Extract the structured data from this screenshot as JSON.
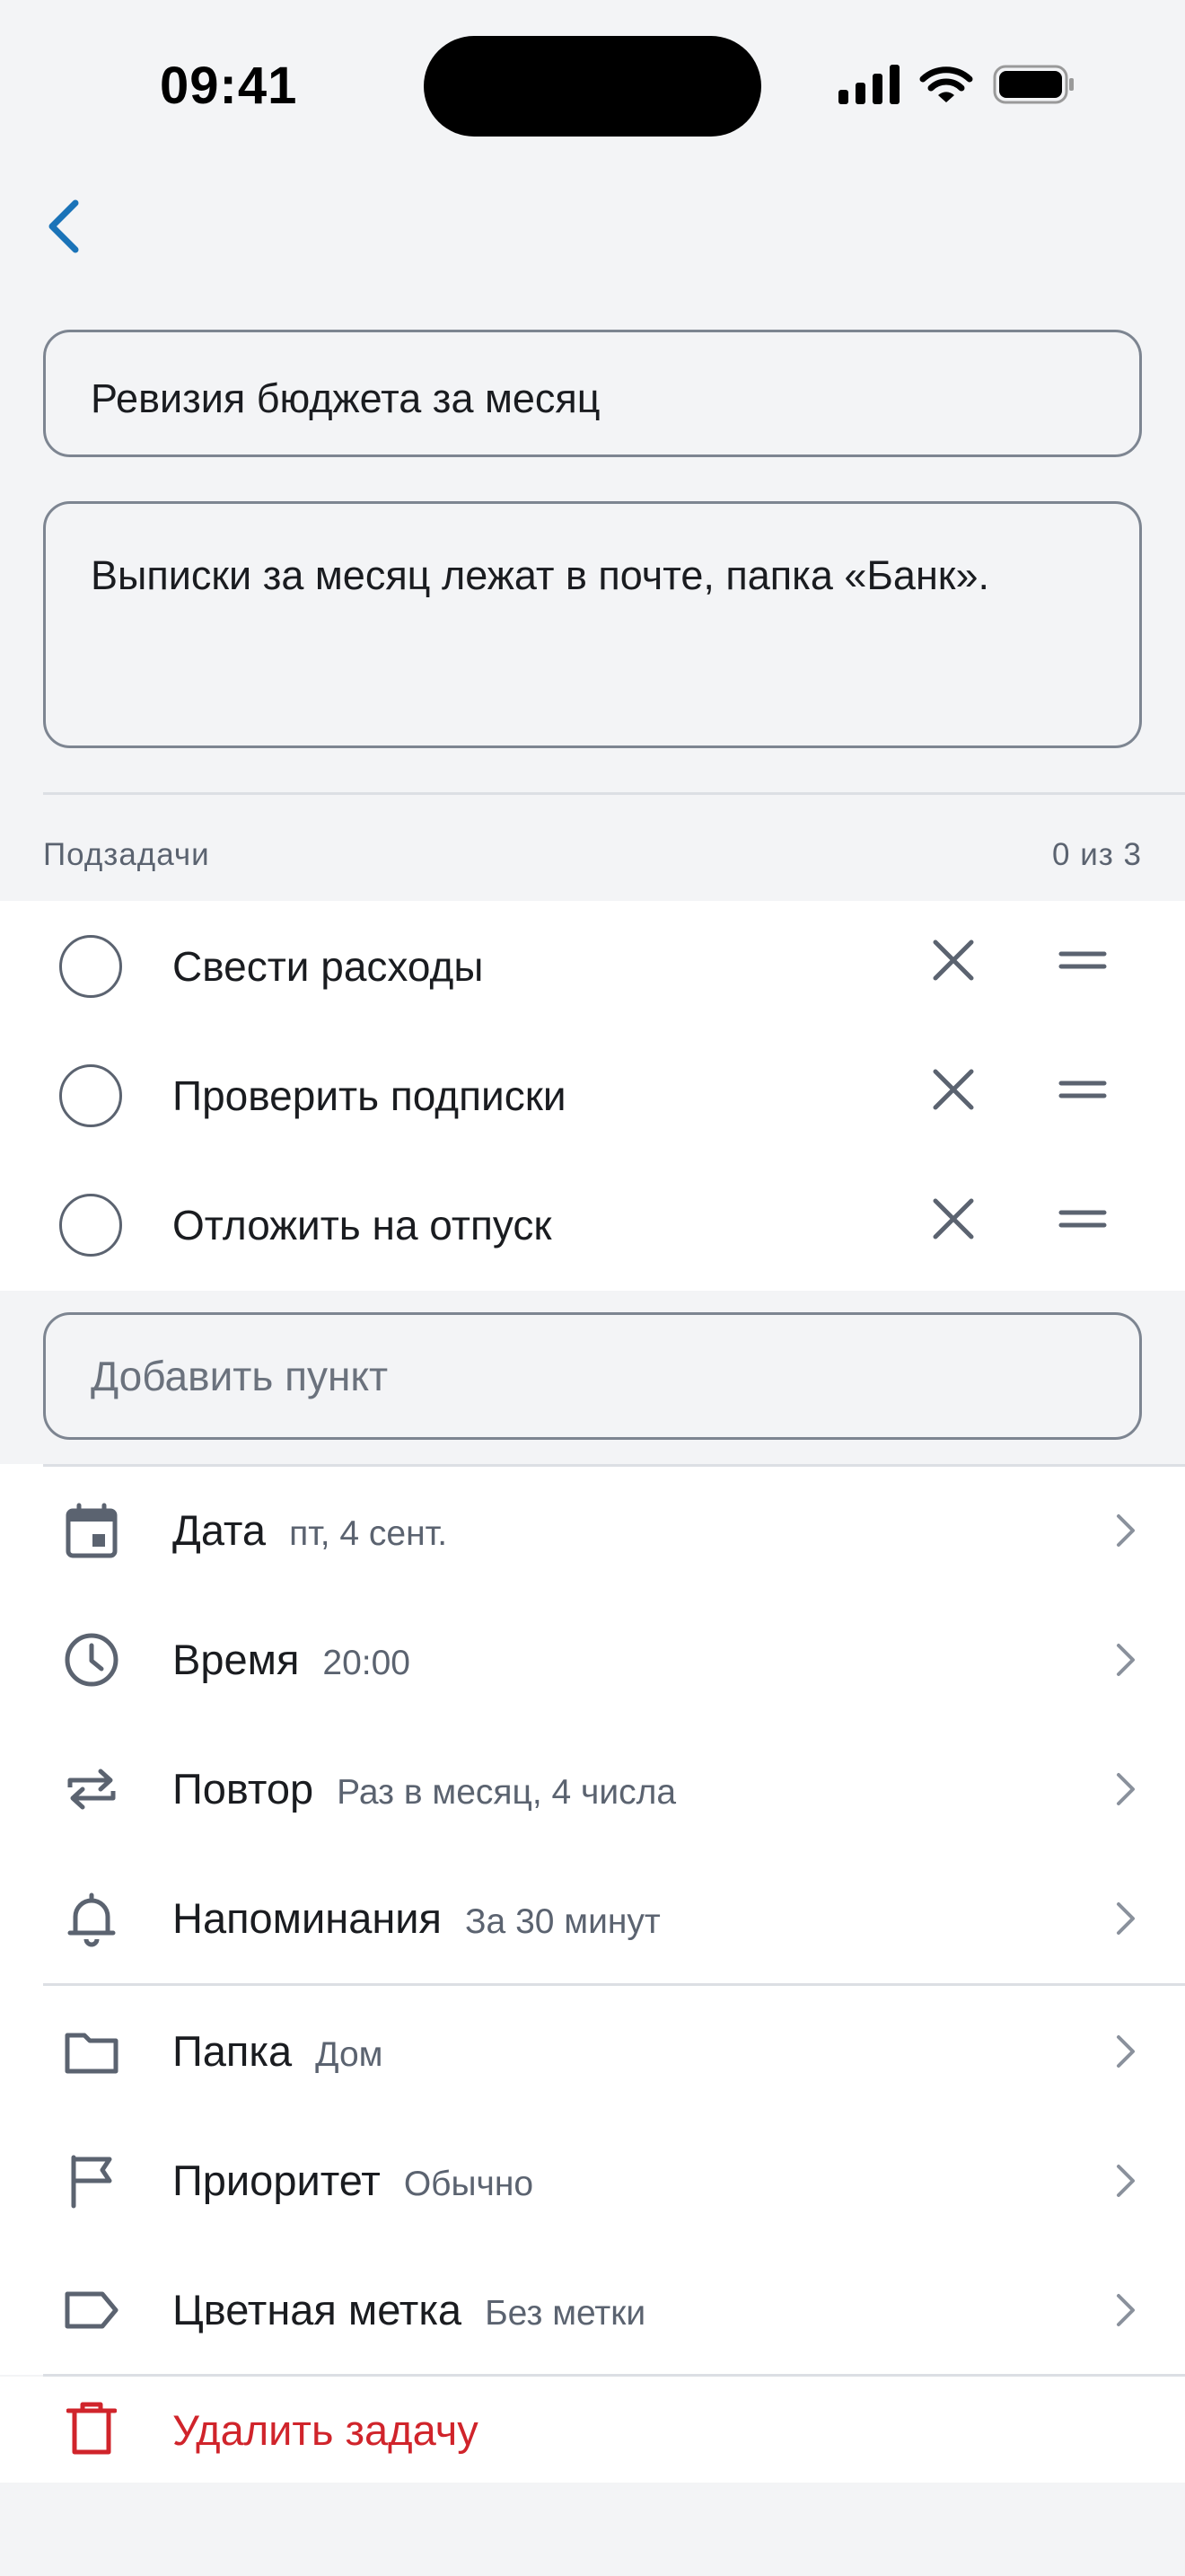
{
  "status_bar": {
    "time": "09:41"
  },
  "task": {
    "title": "Ревизия бюджета за месяц",
    "description": "Выписки за месяц лежат в почте, папка «Банк»."
  },
  "subtasks": {
    "header": "Подзадачи",
    "count": "0 из 3",
    "items": [
      {
        "label": "Свести расходы",
        "done": false
      },
      {
        "label": "Проверить подписки",
        "done": false
      },
      {
        "label": "Отложить на отпуск",
        "done": false
      }
    ],
    "add_placeholder": "Добавить пункт"
  },
  "schedule": [
    {
      "icon": "calendar-icon",
      "name": "Дата",
      "value": "пт, 4 сент."
    },
    {
      "icon": "clock-icon",
      "name": "Время",
      "value": "20:00"
    },
    {
      "icon": "repeat-icon",
      "name": "Повтор",
      "value": "Раз в месяц, 4 числа"
    },
    {
      "icon": "bell-icon",
      "name": "Напоминания",
      "value": "За 30 минут"
    }
  ],
  "organize": [
    {
      "icon": "folder-icon",
      "name": "Папка",
      "value": "Дом"
    },
    {
      "icon": "flag-icon",
      "name": "Приоритет",
      "value": "Обычно"
    },
    {
      "icon": "tag-icon",
      "name": "Цветная метка",
      "value": "Без метки"
    }
  ],
  "delete_label": "Удалить задачу",
  "colors": {
    "accent": "#1a73b8",
    "danger": "#d0242b",
    "icon": "#5b6370",
    "background": "#f3f4f6"
  }
}
